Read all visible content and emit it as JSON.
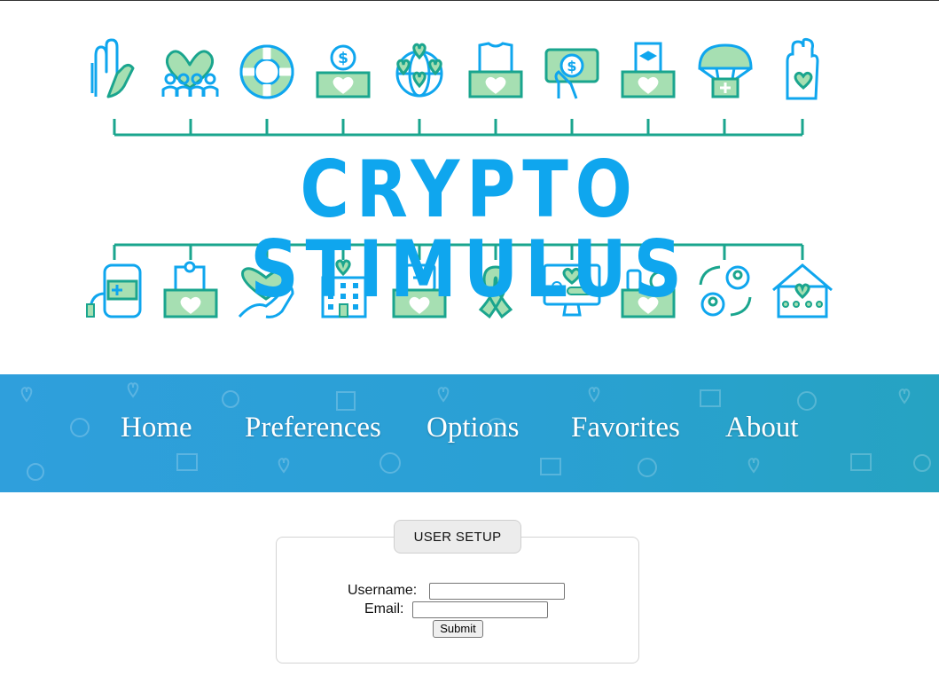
{
  "banner": {
    "title": "CRYPTO STIMULUS",
    "top_icons": [
      "raised-hands-icon",
      "heart-community-icon",
      "lifebuoy-icon",
      "dollar-donation-box-icon",
      "globe-hearts-icon",
      "clothes-donation-box-icon",
      "hand-money-icon",
      "education-donation-box-icon",
      "parachute-aid-icon",
      "hand-heart-icon"
    ],
    "bottom_icons": [
      "blood-bag-icon",
      "puzzle-donation-box-icon",
      "heart-in-hands-icon",
      "hospital-icon",
      "medical-donation-box-icon",
      "awareness-ribbon-icon",
      "online-donation-monitor-icon",
      "food-donation-box-icon",
      "volunteer-exchange-icon",
      "shelter-house-icon"
    ]
  },
  "nav": {
    "items": [
      {
        "label": "Home"
      },
      {
        "label": "Preferences"
      },
      {
        "label": "Options"
      },
      {
        "label": "Favorites"
      },
      {
        "label": "About"
      }
    ]
  },
  "form": {
    "legend": "USER SETUP",
    "username_label": "Username:",
    "username_value": "",
    "email_label": "Email:",
    "email_value": "",
    "submit_label": "Submit"
  },
  "colors": {
    "title_blue": "#0fa6ee",
    "icon_teal": "#1aa58e",
    "icon_green_fill": "#a6dfb2",
    "nav_blue": "#2aa0d4"
  }
}
